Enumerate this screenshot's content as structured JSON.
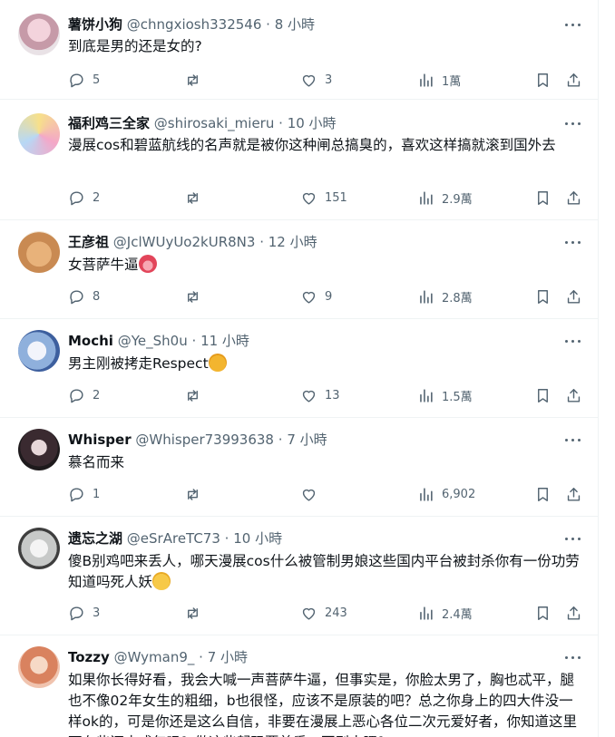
{
  "icons": {
    "reply": "reply-icon",
    "retweet": "retweet-icon",
    "like": "heart-icon",
    "views": "views-icon",
    "bookmark": "bookmark-icon",
    "share": "share-icon",
    "more": "more-icon"
  },
  "colors": {
    "secondary_text": "#536471",
    "divider": "#eff3f4"
  },
  "tweets": [
    {
      "name": "薯饼小狗",
      "handle": "@chngxiosh332546",
      "dot": "·",
      "time": "8 小時",
      "text": "到底是男的还是女的?",
      "replies": "5",
      "retweets": "",
      "likes": "3",
      "views": "1萬"
    },
    {
      "name": "福利鸡三全家",
      "handle": "@shirosaki_mieru",
      "dot": "·",
      "time": "10 小時",
      "text": "漫展cos和碧蓝航线的名声就是被你这种闸总搞臭的，喜欢这样搞就滚到国外去",
      "replies": "2",
      "retweets": "",
      "likes": "151",
      "views": "2.9萬"
    },
    {
      "name": "王彦祖",
      "handle": "@JclWUyUo2kUR8N3",
      "dot": "·",
      "time": "12 小時",
      "text": "女菩萨牛逼",
      "replies": "8",
      "retweets": "",
      "likes": "9",
      "views": "2.8萬"
    },
    {
      "name": "Mochi",
      "handle": "@Ye_Sh0u",
      "dot": "·",
      "time": "11 小時",
      "text": "男主刚被拷走Respect",
      "replies": "2",
      "retweets": "",
      "likes": "13",
      "views": "1.5萬"
    },
    {
      "name": "Whisper",
      "handle": "@Whisper73993638",
      "dot": "·",
      "time": "7 小時",
      "text": "慕名而来",
      "replies": "1",
      "retweets": "",
      "likes": "",
      "views": "6,902"
    },
    {
      "name": "遗忘之湖",
      "handle": "@eSrAreTC73",
      "dot": "·",
      "time": "10 小時",
      "text": "傻B别鸡吧来丢人，哪天漫展cos什么被管制男娘这些国内平台被封杀你有一份功劳知道吗死人妖",
      "replies": "3",
      "retweets": "",
      "likes": "243",
      "views": "2.4萬"
    },
    {
      "name": "Tozzy",
      "handle": "@Wyman9_",
      "dot": "·",
      "time": "7 小時",
      "text": "如果你长得好看，我会大喊一声菩萨牛逼，但事实是，你脸太男了，胸也忒平，腿也不像02年女生的粗细，b也很怪，应该不是原装的吧？总之你身上的四大件没一样ok的，可是你还是这么自信，非要在漫展上恶心各位二次元爱好者，你知道这里面有些还未成年吗？做这些起码要美重，否则太嘿？",
      "replies": "",
      "retweets": "",
      "likes": "",
      "views": ""
    }
  ]
}
